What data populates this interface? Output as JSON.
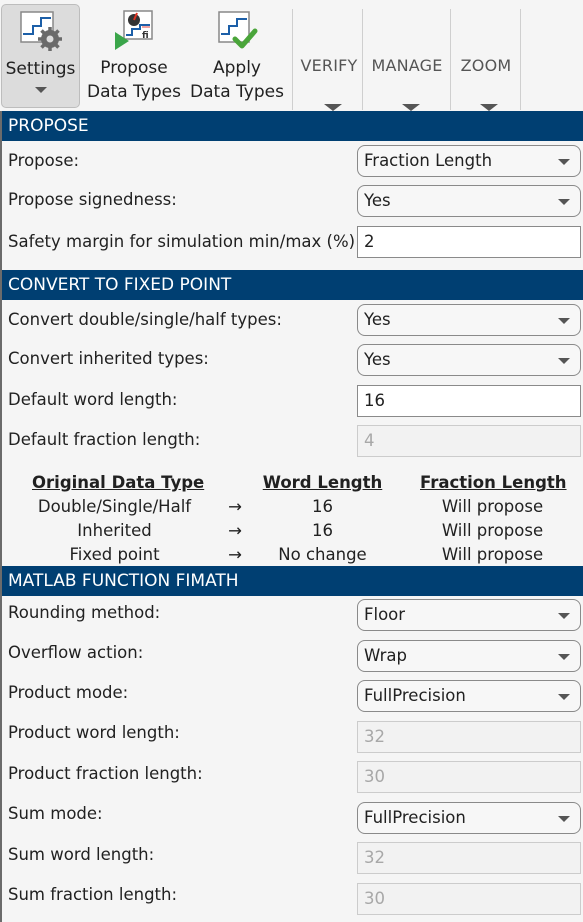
{
  "toolbar": {
    "buttons": [
      {
        "label_line1": "Settings",
        "label_line2": "",
        "icon": "settings-gear-icon",
        "active": true
      },
      {
        "label_line1": "Propose",
        "label_line2": "Data Types",
        "icon": "propose-data-types-icon"
      },
      {
        "label_line1": "Apply",
        "label_line2": "Data Types",
        "icon": "apply-data-types-icon"
      }
    ],
    "sections": [
      {
        "label": "VERIFY"
      },
      {
        "label": "MANAGE"
      },
      {
        "label": "ZOOM"
      }
    ]
  },
  "propose": {
    "header": "PROPOSE",
    "propose_label": "Propose:",
    "propose_value": "Fraction Length",
    "signedness_label": "Propose signedness:",
    "signedness_value": "Yes",
    "safety_label": "Safety margin for simulation min/max (%):",
    "safety_value": "2"
  },
  "convert": {
    "header": "CONVERT TO FIXED POINT",
    "convert_dsh_label": "Convert double/single/half types:",
    "convert_dsh_value": "Yes",
    "convert_inherited_label": "Convert inherited types:",
    "convert_inherited_value": "Yes",
    "default_wl_label": "Default word length:",
    "default_wl_value": "16",
    "default_fl_label": "Default fraction length:",
    "default_fl_value": "4",
    "table": {
      "headers": [
        "Original Data Type",
        "Word Length",
        "Fraction Length"
      ],
      "arrow": "→",
      "rows": [
        [
          "Double/Single/Half",
          "16",
          "Will propose"
        ],
        [
          "Inherited",
          "16",
          "Will propose"
        ],
        [
          "Fixed point",
          "No change",
          "Will propose"
        ]
      ]
    }
  },
  "fimath": {
    "header": "MATLAB FUNCTION FIMATH",
    "rounding_label": "Rounding method:",
    "rounding_value": "Floor",
    "overflow_label": "Overflow action:",
    "overflow_value": "Wrap",
    "product_mode_label": "Product mode:",
    "product_mode_value": "FullPrecision",
    "product_wl_label": "Product word length:",
    "product_wl_value": "32",
    "product_fl_label": "Product fraction length:",
    "product_fl_value": "30",
    "sum_mode_label": "Sum mode:",
    "sum_mode_value": "FullPrecision",
    "sum_wl_label": "Sum word length:",
    "sum_wl_value": "32",
    "sum_fl_label": "Sum fraction length:",
    "sum_fl_value": "30"
  }
}
